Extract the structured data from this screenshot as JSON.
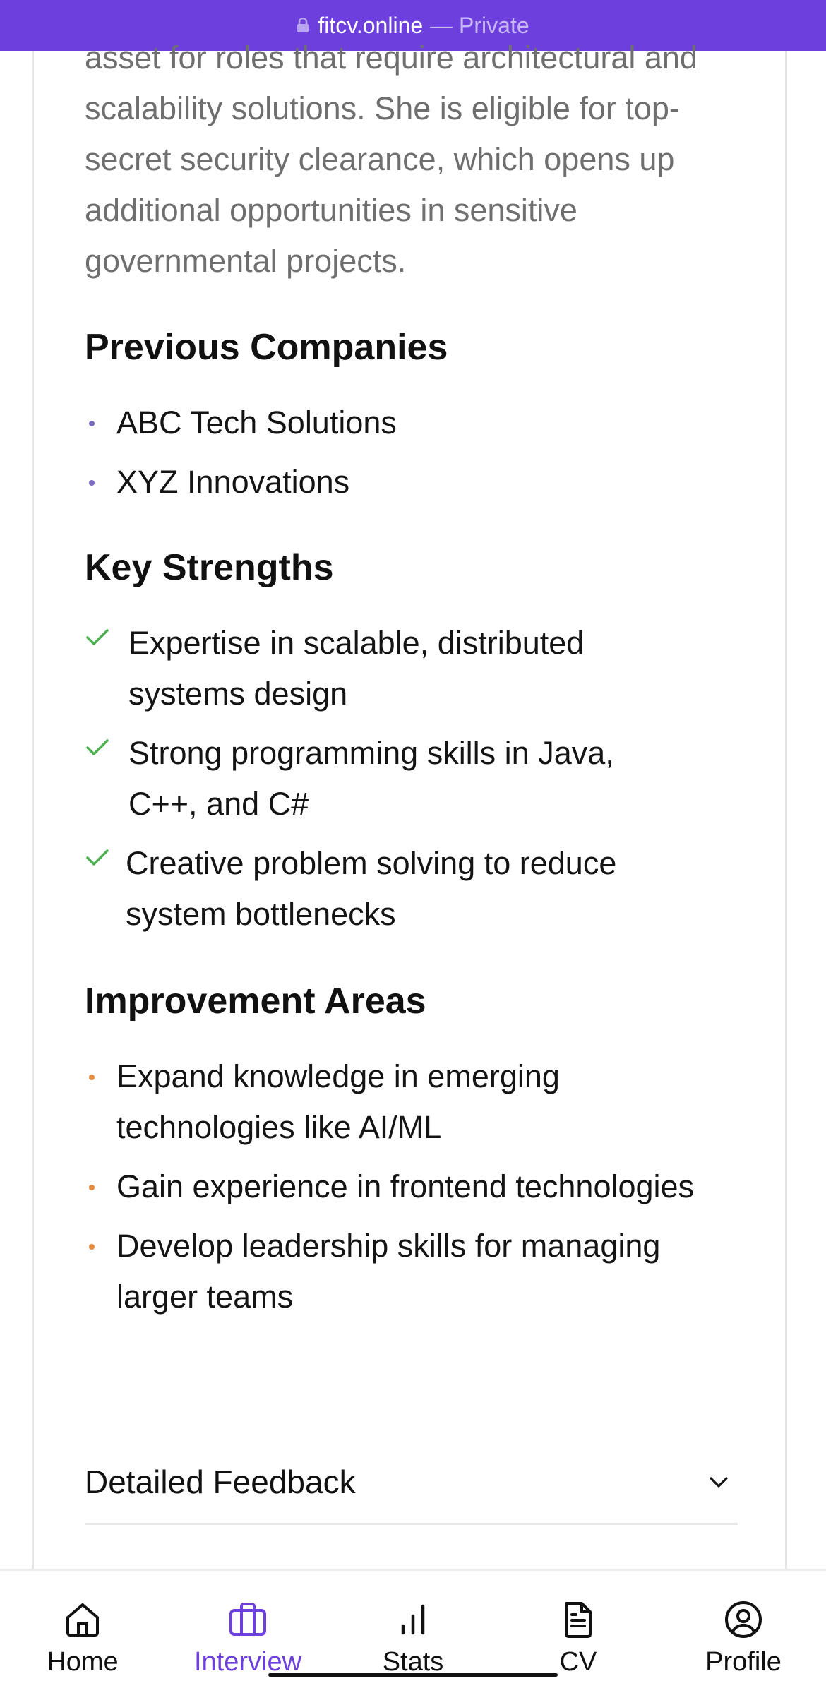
{
  "browser": {
    "domain": "fitcv.online",
    "mode": "— Private"
  },
  "summary_text": "asset for roles that require architectural and scalability solutions. She is eligible for top-secret security clearance, which opens up additional opportunities in sensitive governmental projects.",
  "previous_companies": {
    "title": "Previous Companies",
    "items": [
      "ABC Tech Solutions",
      "XYZ Innovations"
    ]
  },
  "key_strengths": {
    "title": "Key Strengths",
    "items": [
      "Expertise in scalable, distributed systems design",
      "Strong programming skills in Java, C++, and C#",
      "Creative problem solving to reduce system bottlenecks"
    ]
  },
  "improvement_areas": {
    "title": "Improvement Areas",
    "items": [
      "Expand knowledge in emerging technologies like AI/ML",
      "Gain experience in frontend technologies",
      "Develop leadership skills for managing larger teams"
    ]
  },
  "detailed_feedback": {
    "label": "Detailed Feedback",
    "icon": "chevron-down-icon"
  },
  "tabbar": {
    "tabs": [
      {
        "label": "Home",
        "icon": "home-icon"
      },
      {
        "label": "Interview",
        "icon": "briefcase-icon",
        "active": true
      },
      {
        "label": "Stats",
        "icon": "bar-chart-icon"
      },
      {
        "label": "CV",
        "icon": "document-icon"
      },
      {
        "label": "Profile",
        "icon": "user-circle-icon"
      }
    ]
  },
  "colors": {
    "accent": "#6d3fdc",
    "check": "#4caf50",
    "improve_bullet": "#e58a3d",
    "company_bullet": "#7a6bc0"
  }
}
